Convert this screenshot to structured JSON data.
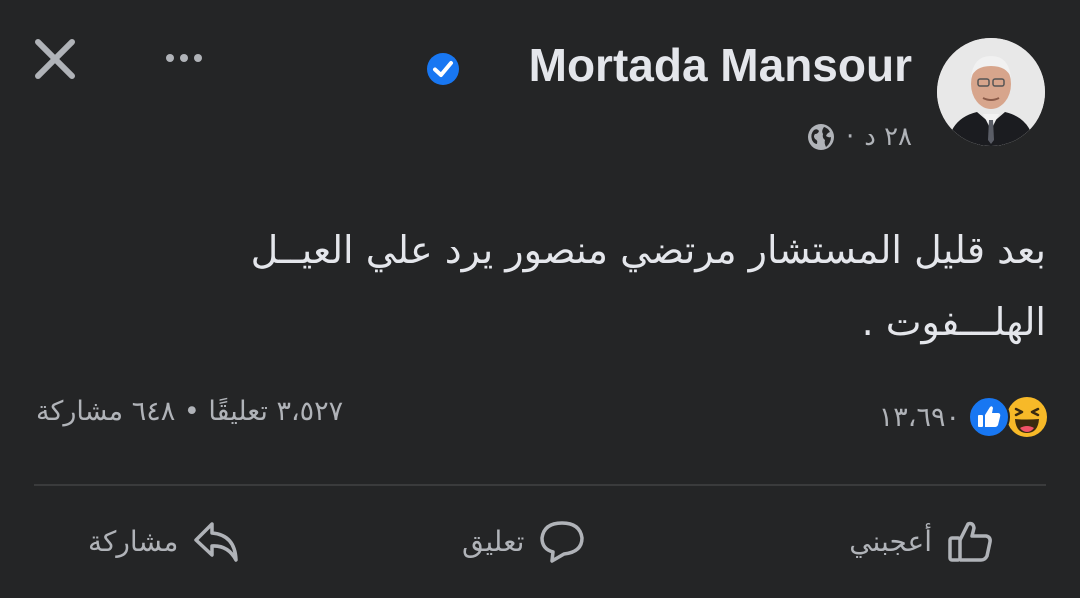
{
  "header": {
    "author_name": "Mortada Mansour",
    "timestamp": "٢٨ د",
    "separator": "·"
  },
  "post": {
    "text_line1": "بعد قليل المستشار مرتضي منصور يرد علي العيــل",
    "text_line2": "الهلـــفوت ."
  },
  "stats": {
    "reaction_count": "١٣،٦٩٠",
    "comments_shares": "٣،٥٢٧ تعليقًا • ٦٤٨ مشاركة"
  },
  "actions": {
    "like_label": "أعجبني",
    "comment_label": "تعليق",
    "share_label": "مشاركة"
  },
  "colors": {
    "background": "#242526",
    "text_primary": "#e4e6eb",
    "text_secondary": "#b0b3b8",
    "like_blue": "#1877f2",
    "haha_yellow": "#f7b928",
    "verified_blue": "#1877f2"
  },
  "icons": {
    "close": "close-icon",
    "more": "more-horizontal-icon",
    "verified": "verified-badge-icon",
    "privacy": "globe-icon",
    "like_reaction": "like-reaction-icon",
    "haha_reaction": "haha-reaction-icon",
    "like": "thumbs-up-icon",
    "comment": "comment-bubble-icon",
    "share": "share-arrow-icon"
  }
}
